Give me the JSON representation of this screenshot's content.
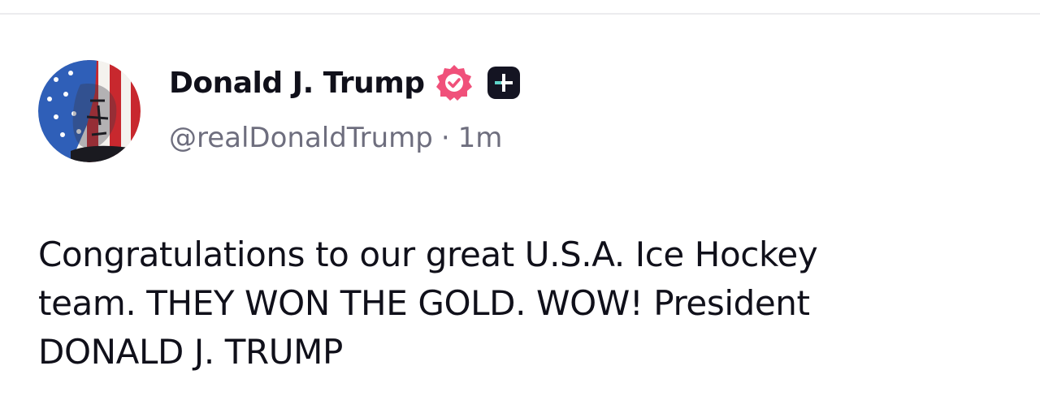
{
  "post": {
    "author": {
      "display_name": "Donald J. Trump",
      "handle": "@realDonaldTrump",
      "verified_badge_icon": "verified-badge-icon",
      "verified_badge_color": "#f0507a",
      "plus_badge_icon": "plus-badge-icon",
      "avatar_icon": "american-flag-portrait-avatar"
    },
    "separator": "·",
    "timestamp": "1m",
    "text": "Congratulations to our great U.S.A. Ice Hockey\nteam. THEY WON THE GOLD. WOW! President\nDONALD J. TRUMP"
  },
  "colors": {
    "text_primary": "#10101a",
    "text_secondary": "#6e6e7e",
    "divider": "#ececee",
    "badge_pink": "#f0507a",
    "badge_dark": "#141422",
    "badge_accent": "#5fd4c8"
  }
}
